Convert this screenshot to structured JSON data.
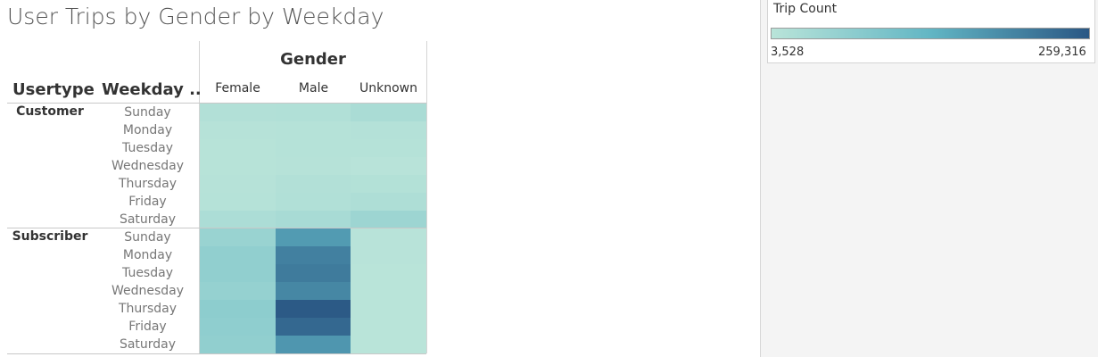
{
  "title": "User Trips by Gender by Weekday",
  "legend": {
    "title": "Trip Count",
    "min_label": "3,528",
    "max_label": "259,316",
    "color_low": "#b9e4d9",
    "color_high": "#2a5784"
  },
  "headers": {
    "gender": "Gender",
    "usertype": "Usertype",
    "weekday": "Weekday .."
  },
  "chart_data": {
    "type": "heatmap",
    "title": "User Trips by Gender by Weekday",
    "columns_label": "Gender",
    "columns": [
      "Female",
      "Male",
      "Unknown"
    ],
    "row_labels": [
      "Usertype",
      "Weekday .."
    ],
    "value_label": "Trip Count",
    "value_range": [
      3528,
      259316
    ],
    "groups": [
      {
        "usertype": "Customer",
        "rows": [
          {
            "weekday": "Sunday",
            "values": [
              14000,
              16000,
              25000
            ]
          },
          {
            "weekday": "Monday",
            "values": [
              8000,
              10000,
              11000
            ]
          },
          {
            "weekday": "Tuesday",
            "values": [
              7000,
              10000,
              9000
            ]
          },
          {
            "weekday": "Wednesday",
            "values": [
              7000,
              8000,
              5000
            ]
          },
          {
            "weekday": "Thursday",
            "values": [
              8000,
              14000,
              13000
            ]
          },
          {
            "weekday": "Friday",
            "values": [
              9000,
              16000,
              20000
            ]
          },
          {
            "weekday": "Saturday",
            "values": [
              22000,
              28000,
              45000
            ]
          }
        ]
      },
      {
        "usertype": "Subscriber",
        "rows": [
          {
            "weekday": "Sunday",
            "values": [
              50000,
              168000,
              5000
            ]
          },
          {
            "weekday": "Monday",
            "values": [
              62000,
              204000,
              5000
            ]
          },
          {
            "weekday": "Tuesday",
            "values": [
              62000,
              211000,
              4000
            ]
          },
          {
            "weekday": "Wednesday",
            "values": [
              56000,
              195000,
              4000
            ]
          },
          {
            "weekday": "Thursday",
            "values": [
              68000,
              255000,
              4000
            ]
          },
          {
            "weekday": "Friday",
            "values": [
              65000,
              236000,
              4000
            ]
          },
          {
            "weekday": "Saturday",
            "values": [
              62000,
              174000,
              4000
            ]
          }
        ]
      }
    ]
  }
}
